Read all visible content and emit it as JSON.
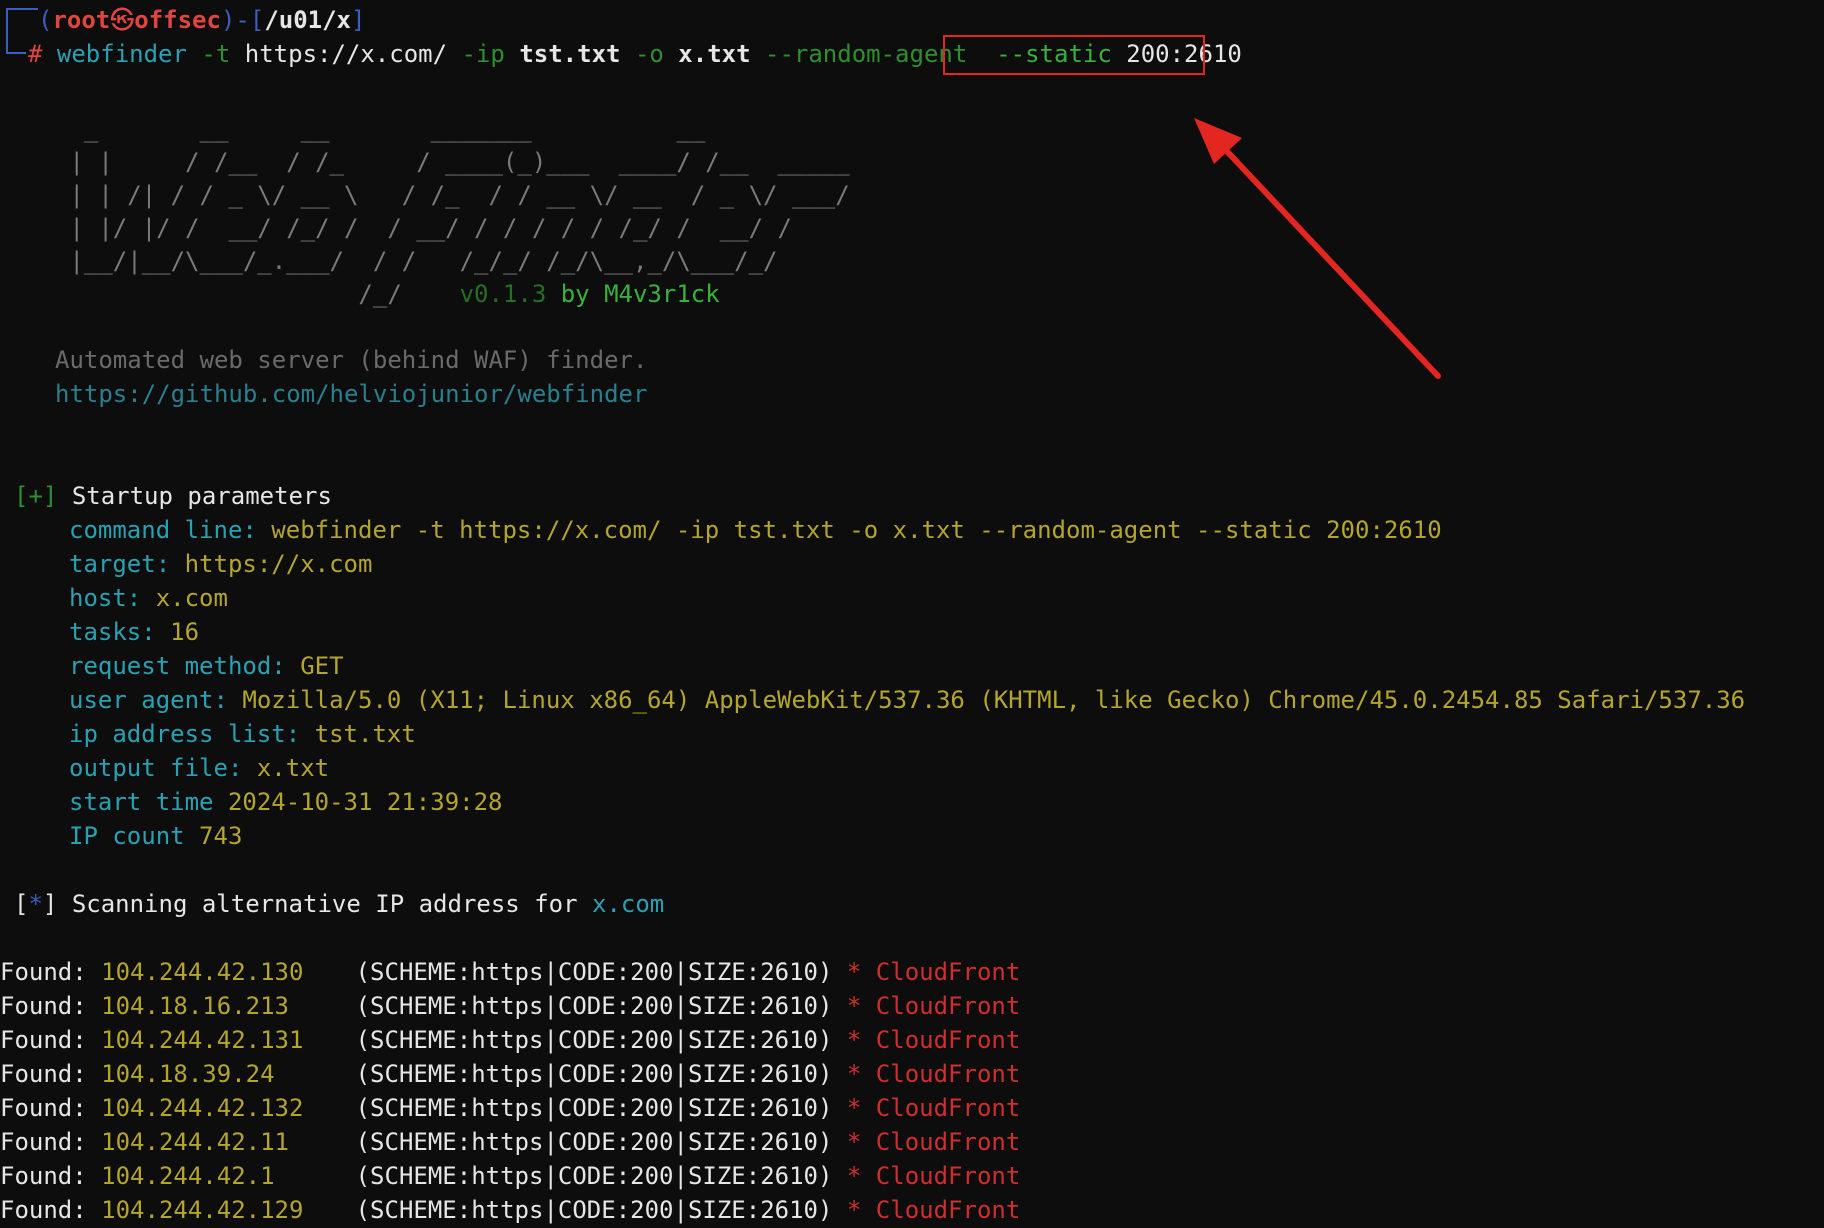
{
  "prompt": {
    "user": "root",
    "at": "㉿",
    "host": "offsec",
    "cwd": "/u01/x",
    "hash": "#",
    "cmd": "webfinder",
    "f_t": "-t",
    "url": "https://x.com/",
    "f_ip": "-ip",
    "ipfile": "tst.txt",
    "f_o": "-o",
    "outfile": "x.txt",
    "f_agent": "--random-agent",
    "f_static": "--static",
    "static_val": "200:2610"
  },
  "banner": {
    "art": [
      "  _       __     __       _______          __",
      " | |     / /__  / /_     / ____(_)___  ____/ /__  _____",
      " | | /| / / _ \\/ __ \\   / /_  / / __ \\/ __  / _ \\/ ___/",
      " | |/ |/ /  __/ /_/ /  / __/ / / / / / /_/ /  __/ /",
      " |__/|__/\\___/_.___/  / /   /_/_/ /_/\\__,_/\\___/_/",
      "                     /_/"
    ],
    "version": "v0.1.3",
    "by": "by M4v3r1ck",
    "tagline": "Automated web server (behind WAF) finder.",
    "repo": "https://github.com/helviojunior/webfinder"
  },
  "startup": {
    "marker": "[+]",
    "heading": "Startup parameters",
    "params": [
      {
        "key": "command line:",
        "value": "webfinder -t https://x.com/ -ip tst.txt -o x.txt --random-agent --static 200:2610"
      },
      {
        "key": "target:",
        "value": "https://x.com"
      },
      {
        "key": "host:",
        "value": "x.com"
      },
      {
        "key": "tasks:",
        "value": "16"
      },
      {
        "key": "request method:",
        "value": "GET"
      },
      {
        "key": "user agent:",
        "value": "Mozilla/5.0 (X11; Linux x86_64) AppleWebKit/537.36 (KHTML, like Gecko) Chrome/45.0.2454.85 Safari/537.36"
      },
      {
        "key": "ip address list:",
        "value": "tst.txt"
      },
      {
        "key": "output file:",
        "value": "x.txt"
      },
      {
        "key": "start time",
        "value": "2024-10-31 21:39:28"
      },
      {
        "key": "IP count",
        "value": "743"
      }
    ]
  },
  "scan": {
    "marker_open": "[",
    "marker_star": "*",
    "marker_close": "]",
    "text": "Scanning alternative IP address for",
    "host": "x.com"
  },
  "results": [
    {
      "label": "Found:",
      "ip": "104.244.42.130",
      "info": "(SCHEME:https|CODE:200|SIZE:2610)",
      "star": "*",
      "cdn": "CloudFront"
    },
    {
      "label": "Found:",
      "ip": "104.18.16.213",
      "info": "(SCHEME:https|CODE:200|SIZE:2610)",
      "star": "*",
      "cdn": "CloudFront"
    },
    {
      "label": "Found:",
      "ip": "104.244.42.131",
      "info": "(SCHEME:https|CODE:200|SIZE:2610)",
      "star": "*",
      "cdn": "CloudFront"
    },
    {
      "label": "Found:",
      "ip": "104.18.39.24",
      "info": "(SCHEME:https|CODE:200|SIZE:2610)",
      "star": "*",
      "cdn": "CloudFront"
    },
    {
      "label": "Found:",
      "ip": "104.244.42.132",
      "info": "(SCHEME:https|CODE:200|SIZE:2610)",
      "star": "*",
      "cdn": "CloudFront"
    },
    {
      "label": "Found:",
      "ip": "104.244.42.11",
      "info": "(SCHEME:https|CODE:200|SIZE:2610)",
      "star": "*",
      "cdn": "CloudFront"
    },
    {
      "label": "Found:",
      "ip": "104.244.42.1",
      "info": "(SCHEME:https|CODE:200|SIZE:2610)",
      "star": "*",
      "cdn": "CloudFront"
    },
    {
      "label": "Found:",
      "ip": "104.244.42.129",
      "info": "(SCHEME:https|CODE:200|SIZE:2610)",
      "star": "*",
      "cdn": "CloudFront"
    }
  ],
  "colors": {
    "background": "#0d0d0d",
    "highlight": "#e3261f",
    "arrow": "#e3261f"
  }
}
